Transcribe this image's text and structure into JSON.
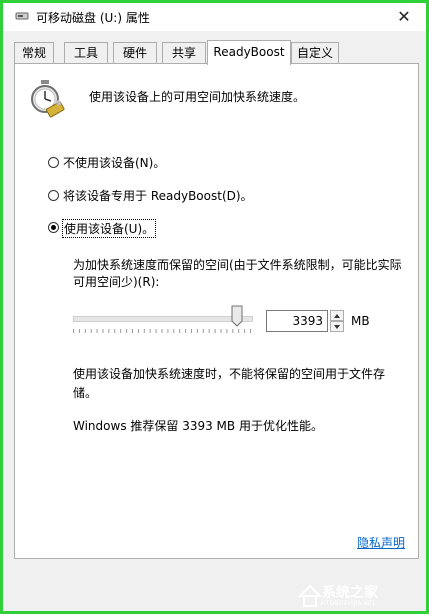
{
  "window": {
    "title": "可移动磁盘 (U:) 属性",
    "close_glyph": "✕"
  },
  "tabs": [
    {
      "label": "常规",
      "active": false
    },
    {
      "label": "工具",
      "active": false
    },
    {
      "label": "硬件",
      "active": false
    },
    {
      "label": "共享",
      "active": false
    },
    {
      "label": "ReadyBoost",
      "active": true
    },
    {
      "label": "自定义",
      "active": false
    }
  ],
  "panel": {
    "header_text": "使用该设备上的可用空间加快系统速度。",
    "options": [
      {
        "label": "不使用该设备(N)。",
        "selected": false
      },
      {
        "label": "将该设备专用于 ReadyBoost(D)。",
        "selected": false
      },
      {
        "label": "使用该设备(U)。",
        "selected": true
      }
    ],
    "reserve_label_line1": "为加快系统速度而保留的空间(由于文件系统限制，可能比实际",
    "reserve_label_line2": "可用空间少)(R):",
    "reserve_value": "3393",
    "reserve_unit": "MB",
    "slider_level_fraction": 0.92,
    "note_line1": "使用该设备加快系统速度时，不能将保留的空间用于文件存",
    "note_line2": "储。",
    "recommend_text": "Windows 推荐保留 3393 MB 用于优化性能。",
    "privacy_link": "隐私声明"
  },
  "watermark": {
    "text": "系统之家",
    "subtext": "XITONGZHIJIA.NET"
  },
  "icons": {
    "title": "removable-drive-icon",
    "panel": "readyboost-stopwatch-icon",
    "watermark": "house-logo-icon"
  }
}
